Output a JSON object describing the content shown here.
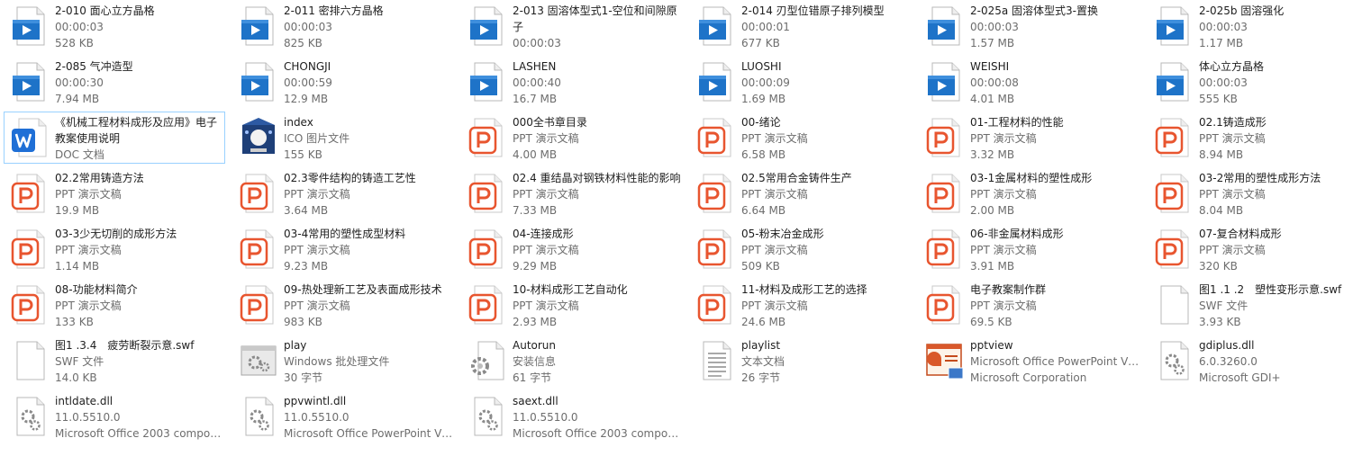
{
  "files": [
    {
      "name": "2-010 面心立方晶格",
      "line2": "00:00:03",
      "line3": "528 KB",
      "icon": "video-icon"
    },
    {
      "name": "2-011 密排六方晶格",
      "line2": "00:00:03",
      "line3": "825 KB",
      "icon": "video-icon"
    },
    {
      "name": "2-013 固溶体型式1-空位和间隙原子",
      "line2": "00:00:03",
      "line3": "",
      "icon": "video-icon",
      "wrap": true
    },
    {
      "name": "2-014 刃型位错原子排列模型",
      "line2": "00:00:01",
      "line3": "677 KB",
      "icon": "video-icon"
    },
    {
      "name": "2-025a 固溶体型式3-置换",
      "line2": "00:00:03",
      "line3": "1.57 MB",
      "icon": "video-icon"
    },
    {
      "name": "2-025b 固溶强化",
      "line2": "00:00:03",
      "line3": "1.17 MB",
      "icon": "video-icon"
    },
    {
      "name": "2-085 气冲造型",
      "line2": "00:00:30",
      "line3": "7.94 MB",
      "icon": "video-icon"
    },
    {
      "name": "CHONGJI",
      "line2": "00:00:59",
      "line3": "12.9 MB",
      "icon": "video-icon"
    },
    {
      "name": "LASHEN",
      "line2": "00:00:40",
      "line3": "16.7 MB",
      "icon": "video-icon"
    },
    {
      "name": "LUOSHI",
      "line2": "00:00:09",
      "line3": "1.69 MB",
      "icon": "video-icon"
    },
    {
      "name": "WEISHI",
      "line2": "00:00:08",
      "line3": "4.01 MB",
      "icon": "video-icon"
    },
    {
      "name": "体心立方晶格",
      "line2": "00:00:03",
      "line3": "555 KB",
      "icon": "video-icon"
    },
    {
      "name": "《机械工程材料成形及应用》电子教案使用说明",
      "line2": "DOC 文档",
      "line3": "",
      "icon": "wps-doc-icon",
      "wrap": true,
      "selected": true
    },
    {
      "name": "index",
      "line2": "ICO 图片文件",
      "line3": "155 KB",
      "icon": "ico-image-icon"
    },
    {
      "name": "000全书章目录",
      "line2": "PPT 演示文稿",
      "line3": "4.00 MB",
      "icon": "ppt-icon"
    },
    {
      "name": "00-绪论",
      "line2": "PPT 演示文稿",
      "line3": "6.58 MB",
      "icon": "ppt-icon"
    },
    {
      "name": "01-工程材料的性能",
      "line2": "PPT 演示文稿",
      "line3": "3.32 MB",
      "icon": "ppt-icon"
    },
    {
      "name": "02.1铸造成形",
      "line2": "PPT 演示文稿",
      "line3": "8.94 MB",
      "icon": "ppt-icon"
    },
    {
      "name": "02.2常用铸造方法",
      "line2": "PPT 演示文稿",
      "line3": "19.9 MB",
      "icon": "ppt-icon"
    },
    {
      "name": "02.3零件结构的铸造工艺性",
      "line2": "PPT 演示文稿",
      "line3": "3.64 MB",
      "icon": "ppt-icon"
    },
    {
      "name": "02.4 重结晶对钢铁材料性能的影响",
      "line2": "PPT 演示文稿",
      "line3": "7.33 MB",
      "icon": "ppt-icon"
    },
    {
      "name": "02.5常用合金铸件生产",
      "line2": "PPT 演示文稿",
      "line3": "6.64 MB",
      "icon": "ppt-icon"
    },
    {
      "name": "03-1金属材料的塑性成形",
      "line2": "PPT 演示文稿",
      "line3": "2.00 MB",
      "icon": "ppt-icon"
    },
    {
      "name": "03-2常用的塑性成形方法",
      "line2": "PPT 演示文稿",
      "line3": "8.04 MB",
      "icon": "ppt-icon"
    },
    {
      "name": "03-3少无切削的成形方法",
      "line2": "PPT 演示文稿",
      "line3": "1.14 MB",
      "icon": "ppt-icon"
    },
    {
      "name": "03-4常用的塑性成型材料",
      "line2": "PPT 演示文稿",
      "line3": "9.23 MB",
      "icon": "ppt-icon"
    },
    {
      "name": "04-连接成形",
      "line2": "PPT 演示文稿",
      "line3": "9.29 MB",
      "icon": "ppt-icon"
    },
    {
      "name": "05-粉末冶金成形",
      "line2": "PPT 演示文稿",
      "line3": "509 KB",
      "icon": "ppt-icon"
    },
    {
      "name": "06-非金属材料成形",
      "line2": "PPT 演示文稿",
      "line3": "3.91 MB",
      "icon": "ppt-icon"
    },
    {
      "name": "07-复合材料成形",
      "line2": "PPT 演示文稿",
      "line3": "320 KB",
      "icon": "ppt-icon"
    },
    {
      "name": "08-功能材料简介",
      "line2": "PPT 演示文稿",
      "line3": "133 KB",
      "icon": "ppt-icon"
    },
    {
      "name": "09-热处理新工艺及表面成形技术",
      "line2": "PPT 演示文稿",
      "line3": "983 KB",
      "icon": "ppt-icon"
    },
    {
      "name": "10-材料成形工艺自动化",
      "line2": "PPT 演示文稿",
      "line3": "2.93 MB",
      "icon": "ppt-icon"
    },
    {
      "name": "11-材料及成形工艺的选择",
      "line2": "PPT 演示文稿",
      "line3": "24.6 MB",
      "icon": "ppt-icon"
    },
    {
      "name": "电子教案制作群",
      "line2": "PPT 演示文稿",
      "line3": "69.5 KB",
      "icon": "ppt-icon"
    },
    {
      "name": "图1 .1 .2　塑性变形示意.swf",
      "line2": "SWF 文件",
      "line3": "3.93 KB",
      "icon": "blank-file-icon"
    },
    {
      "name": "图1 .3.4　疲劳断裂示意.swf",
      "line2": "SWF 文件",
      "line3": "14.0 KB",
      "icon": "blank-file-icon"
    },
    {
      "name": "play",
      "line2": "Windows 批处理文件",
      "line3": "30 字节",
      "icon": "batch-file-icon"
    },
    {
      "name": "Autorun",
      "line2": "安装信息",
      "line3": "61 字节",
      "icon": "setup-info-icon"
    },
    {
      "name": "playlist",
      "line2": "文本文档",
      "line3": "26 字节",
      "icon": "text-file-icon"
    },
    {
      "name": "pptview",
      "line2": "Microsoft Office PowerPoint Vi...",
      "line3": "Microsoft Corporation",
      "icon": "pptview-app-icon"
    },
    {
      "name": "gdiplus.dll",
      "line2": "6.0.3260.0",
      "line3": "Microsoft GDI+",
      "icon": "dll-icon"
    },
    {
      "name": "intldate.dll",
      "line2": "11.0.5510.0",
      "line3": "Microsoft Office 2003 compon...",
      "icon": "dll-icon"
    },
    {
      "name": "ppvwintl.dll",
      "line2": "11.0.5510.0",
      "line3": "Microsoft Office PowerPoint Vi...",
      "icon": "dll-icon"
    },
    {
      "name": "saext.dll",
      "line2": "11.0.5510.0",
      "line3": "Microsoft Office 2003 compon...",
      "icon": "dll-icon"
    }
  ],
  "colors": {
    "selection_border": "#99d1ff",
    "ppt_orange": "#e8552f",
    "video_blue": "#1e73c8",
    "wps_blue": "#1f6fd6",
    "meta_gray": "#6d6d6d"
  }
}
